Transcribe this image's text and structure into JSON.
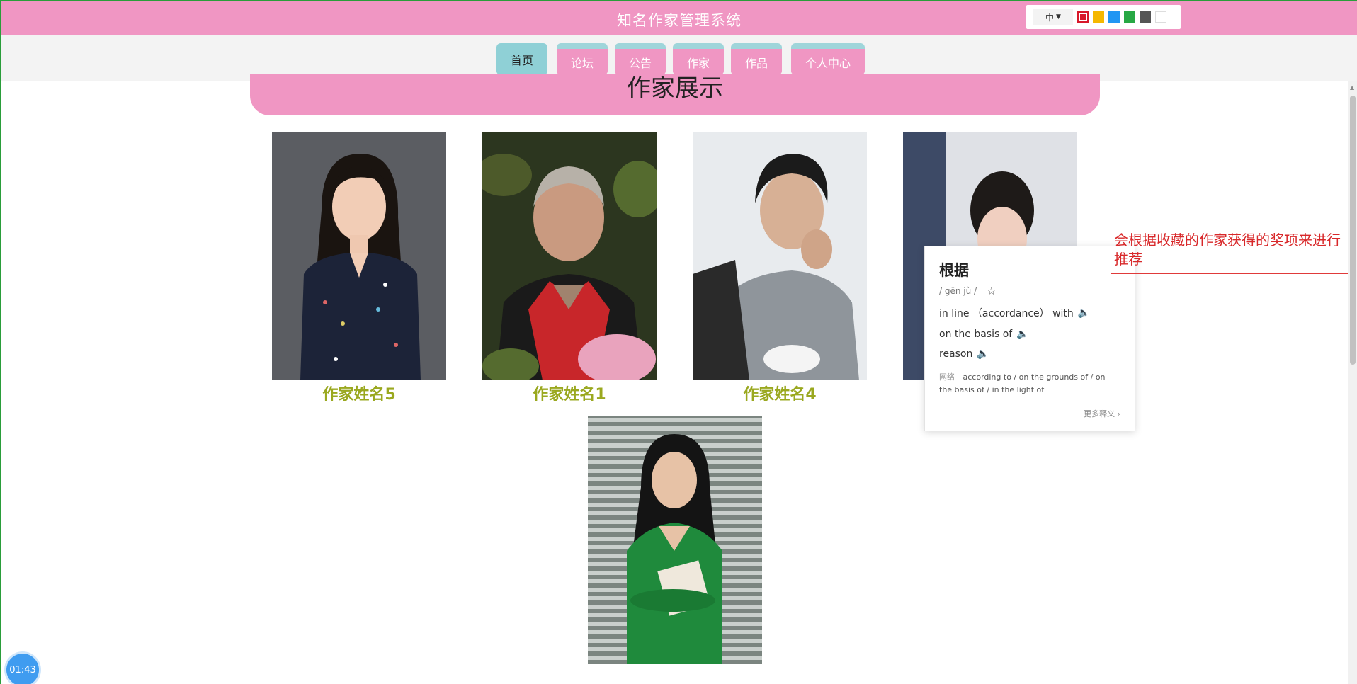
{
  "header": {
    "title": "知名作家管理系统",
    "lang_label": "中",
    "colors": [
      "#d8182a",
      "#f5b800",
      "#2196f3",
      "#27a844",
      "#555555",
      "#ffffff"
    ]
  },
  "nav": {
    "items": [
      {
        "label": "首页",
        "active": true
      },
      {
        "label": "论坛"
      },
      {
        "label": "公告"
      },
      {
        "label": "作家"
      },
      {
        "label": "作品"
      },
      {
        "label": "个人中心"
      }
    ]
  },
  "section": {
    "title": "作家展示"
  },
  "writers": [
    {
      "name": "作家姓名5"
    },
    {
      "name": "作家姓名1"
    },
    {
      "name": "作家姓名4"
    },
    {
      "name": ""
    },
    {
      "name": ""
    }
  ],
  "dictionary": {
    "word": "根据",
    "pinyin": "/ gēn jù /",
    "meanings": [
      "in line （accordance） with",
      "on the basis of",
      "reason"
    ],
    "web_label": "网络",
    "web_text": "according to / on the grounds of / on the basis of / in the light of",
    "more_label": "更多释义 ›"
  },
  "annotation": {
    "text": "会根据收藏的作家获得的奖项来进行推荐"
  },
  "timer": {
    "value": "01:43"
  }
}
